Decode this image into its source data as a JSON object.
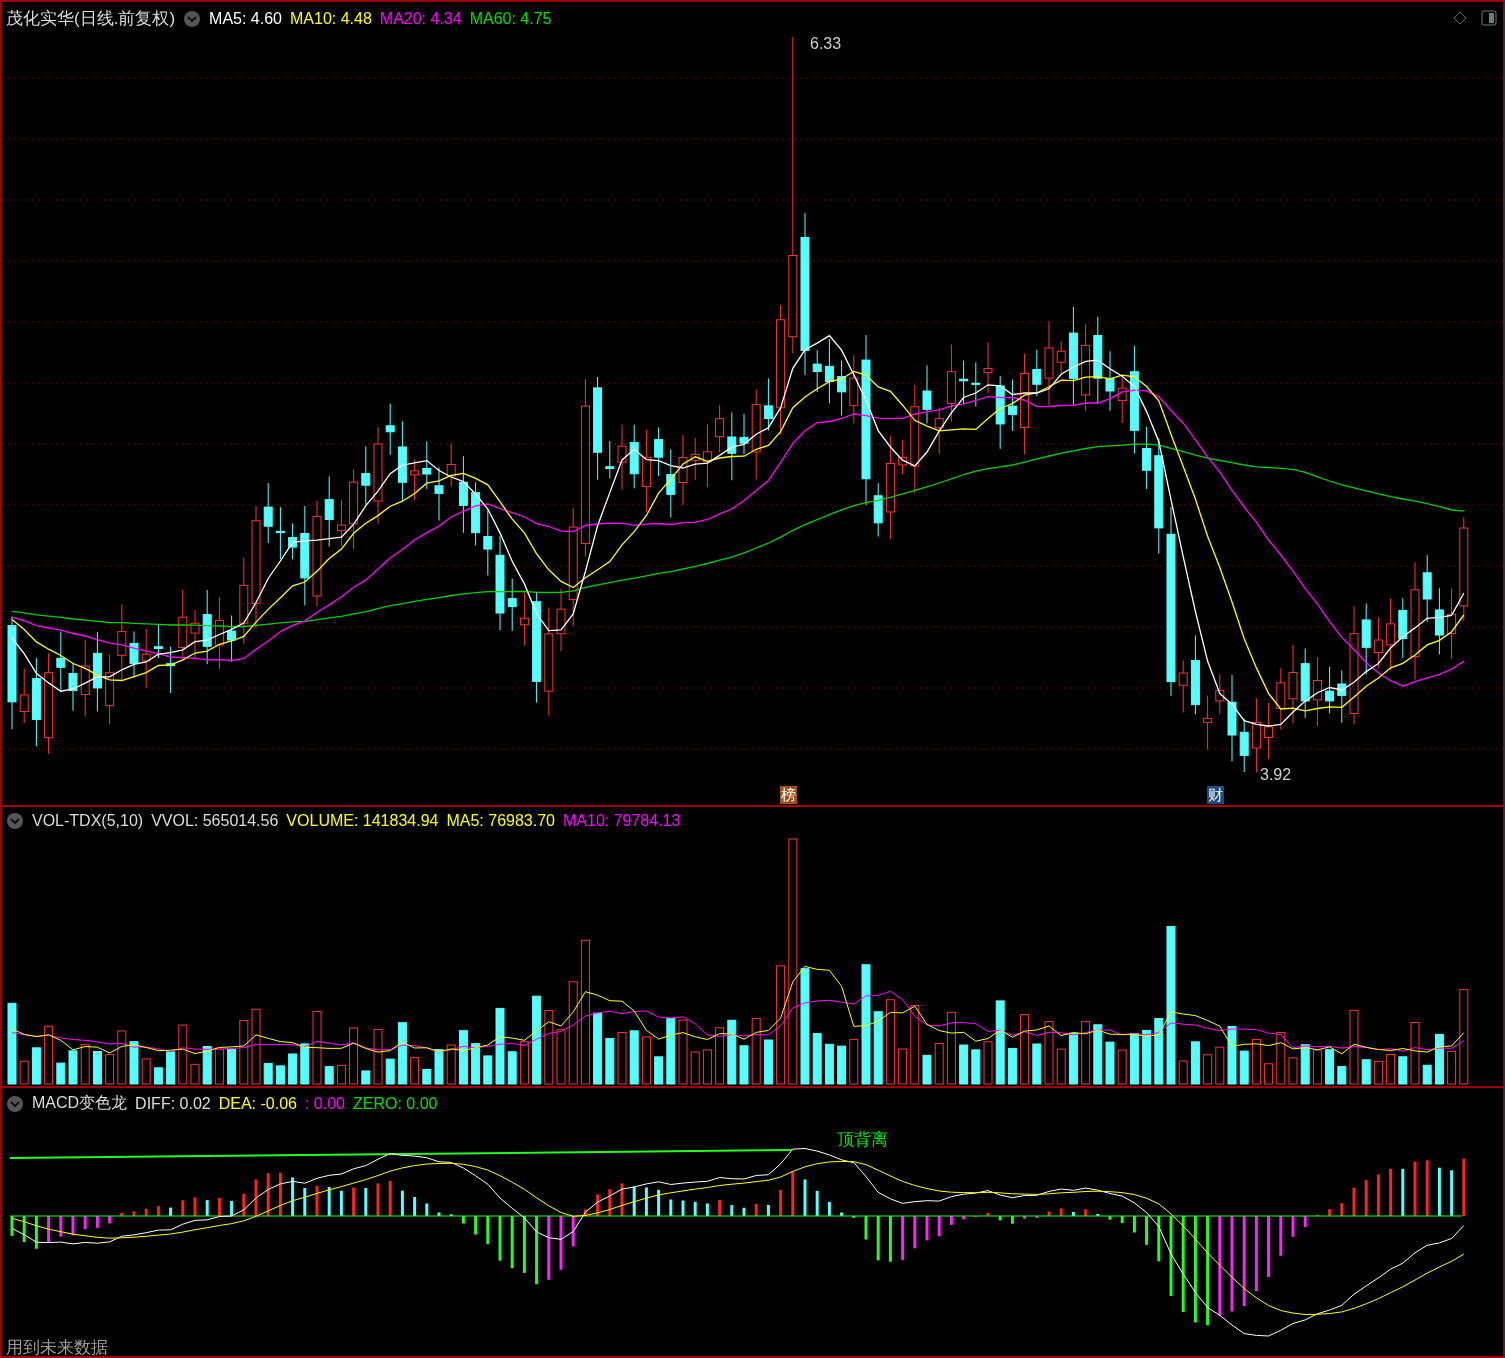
{
  "title": "茂化实华(日线.前复权)",
  "ma_legend": [
    {
      "label": "MA5: 4.60",
      "color": "#ffffff"
    },
    {
      "label": "MA10: 4.48",
      "color": "#ffff00"
    },
    {
      "label": "MA20: 4.34",
      "color": "#ff00ff"
    },
    {
      "label": "MA60: 4.75",
      "color": "#00e000"
    }
  ],
  "price_chart": {
    "high_label": "6.33",
    "low_label": "3.92",
    "badges": [
      {
        "text": "榜",
        "color": "#a0521c"
      },
      {
        "text": "财",
        "color": "#1a4c80"
      }
    ]
  },
  "volume": {
    "legend": [
      {
        "label": "VOL-TDX(5,10)",
        "color": "#dcdcdc"
      },
      {
        "label": "VVOL: 565014.56",
        "color": "#dcdcdc"
      },
      {
        "label": "VOLUME: 141834.94",
        "color": "#ffff00"
      },
      {
        "label": "MA5: 76983.70",
        "color": "#ffff00"
      },
      {
        "label": "MA10: 79784.13",
        "color": "#ff00ff"
      }
    ]
  },
  "macd": {
    "legend": [
      {
        "label": "MACD变色龙",
        "color": "#dcdcdc"
      },
      {
        "label": "DIFF: 0.02",
        "color": "#dcdcdc"
      },
      {
        "label": "DEA: -0.06",
        "color": "#ffff00"
      },
      {
        "label": ": 0.00",
        "color": "#ff00ff"
      },
      {
        "label": "ZERO: 0.00",
        "color": "#00e000"
      }
    ],
    "annotation": "顶背离"
  },
  "footer": "用到未来数据"
}
